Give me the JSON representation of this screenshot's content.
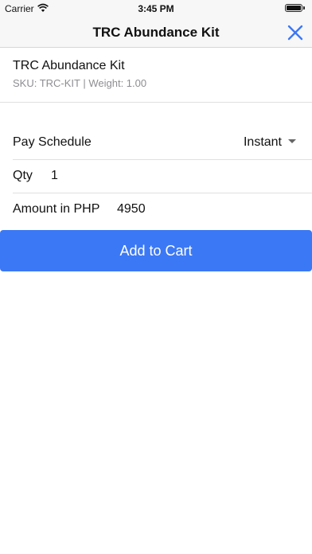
{
  "status_bar": {
    "carrier": "Carrier",
    "time": "3:45 PM",
    "wifi_icon": "wifi-icon",
    "battery_icon": "battery-full-icon"
  },
  "nav": {
    "title": "TRC Abundance Kit",
    "close_icon": "close-icon",
    "accent_color": "#3b78f5"
  },
  "product": {
    "name": "TRC Abundance Kit",
    "meta": "SKU: TRC-KIT | Weight: 1.00"
  },
  "form": {
    "pay_schedule_label": "Pay Schedule",
    "pay_schedule_value": "Instant",
    "qty_label": "Qty",
    "qty_value": "1",
    "amount_label": "Amount in PHP",
    "amount_value": "4950"
  },
  "actions": {
    "add_to_cart_label": "Add to Cart",
    "button_color": "#3b78f5"
  }
}
